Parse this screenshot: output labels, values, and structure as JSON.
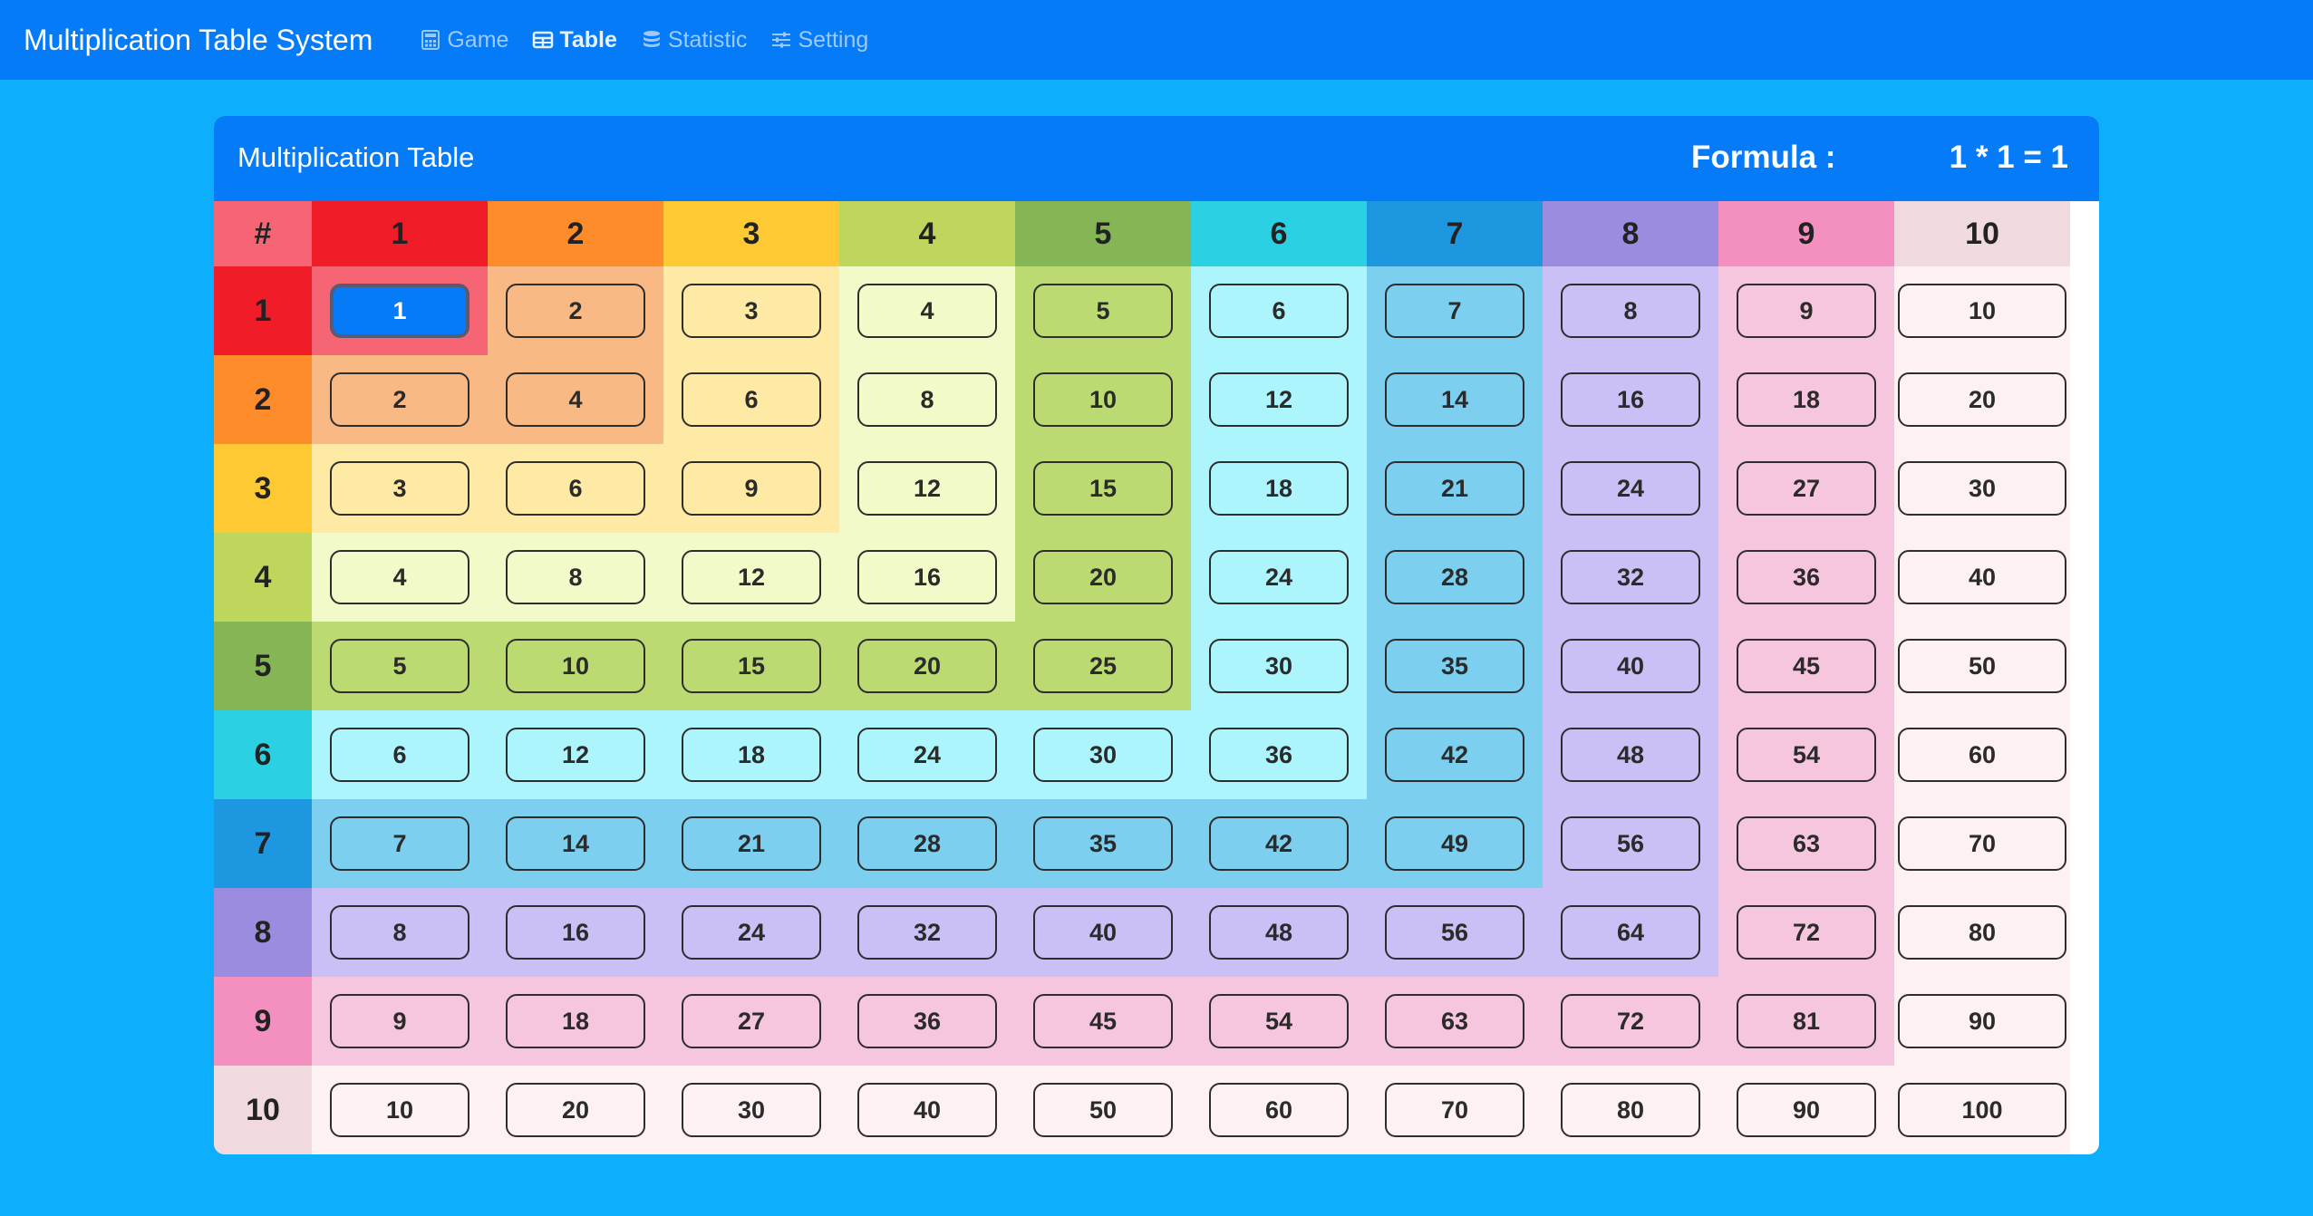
{
  "app": {
    "title": "Multiplication Table System",
    "nav": [
      {
        "label": "Game",
        "icon": "calculator-icon",
        "active": false
      },
      {
        "label": "Table",
        "icon": "table-icon",
        "active": true
      },
      {
        "label": "Statistic",
        "icon": "database-icon",
        "active": false
      },
      {
        "label": "Setting",
        "icon": "sliders-icon",
        "active": false
      }
    ]
  },
  "card": {
    "title": "Multiplication Table",
    "formula_label": "Formula :",
    "formula_value": "1 * 1 = 1"
  },
  "table": {
    "corner_label": "#",
    "size": 10,
    "selected": {
      "row": 1,
      "col": 1
    },
    "header_colors": [
      "#f01d28",
      "#fe8c2a",
      "#fec933",
      "#bdd65b",
      "#86b556",
      "#2bd0e3",
      "#1d97e0",
      "#9b8ce0",
      "#f390c0",
      "#f0dadd"
    ],
    "corner_color": "#f66574",
    "fill_colors": [
      "#f66574",
      "#f9b985",
      "#feeaa5",
      "#f3fac9",
      "#bcda72",
      "#adf5fc",
      "#7ccfee",
      "#cac0f5",
      "#f6c5de",
      "#fdf1f2"
    ],
    "colors": {
      "primary": "#067bf7",
      "background": "#0daffc"
    }
  }
}
